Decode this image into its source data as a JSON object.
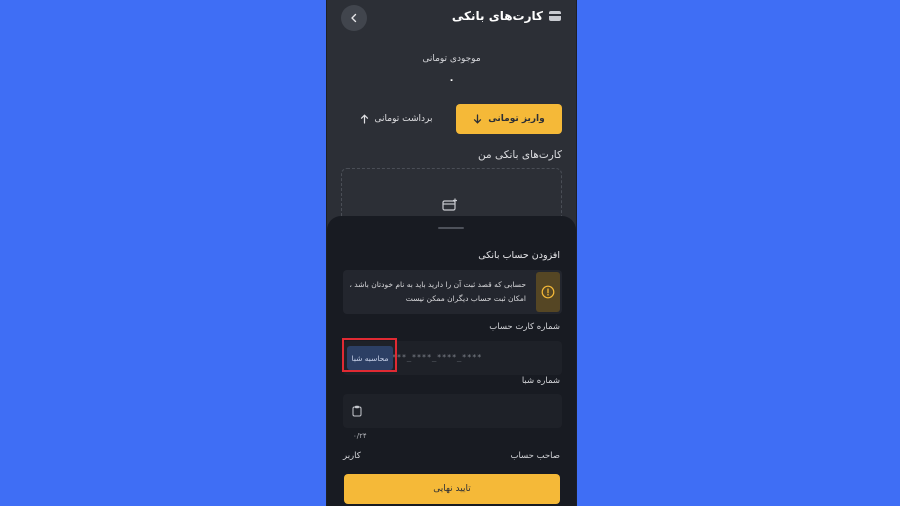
{
  "header": {
    "title": "کارت‌های بانکی",
    "back_icon": "chevron-left-icon",
    "title_icon": "wallet-icon"
  },
  "balance": {
    "label": "موجودی تومانی",
    "value": "۰"
  },
  "actions": {
    "deposit_label": "واریز تومانی",
    "withdraw_label": "برداشت تومانی"
  },
  "cards_section": {
    "title": "کارت‌های بانکی من"
  },
  "sheet": {
    "title": "افزودن حساب بانکی",
    "warning_line1": "حسابی که قصد ثبت آن را دارید باید به نام خودتان باشد ،",
    "warning_line2": "امکان ثبت حساب دیگران ممکن نیست",
    "card_number_label": "شماره کارت حساب",
    "card_number_placeholder": "****_****_****_****",
    "sheba_calc_label": "محاسبه شبا",
    "sheba_label": "شماره شبا",
    "sheba_char_count": "۰/۲۴",
    "owner_label": "صاحب حساب",
    "owner_value": "کاربر",
    "confirm_label": "تایید نهایی"
  },
  "colors": {
    "accent": "#f5b938",
    "background": "#3f6ef5",
    "sheet": "#181b22",
    "highlight": "#e02a33"
  }
}
